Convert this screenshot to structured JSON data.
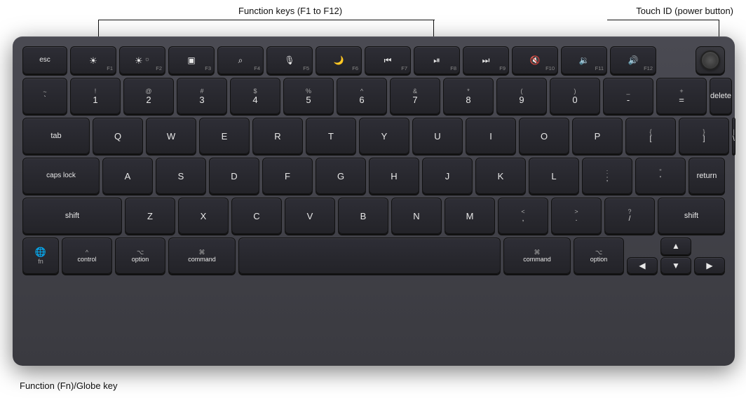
{
  "annotations": {
    "fn_keys_label": "Function keys (F1 to F12)",
    "touchid_label": "Touch ID (power button)",
    "fn_globe_label": "Function (Fn)/Globe key"
  },
  "keyboard": {
    "rows": {
      "fn_row": [
        {
          "id": "esc",
          "primary": "esc",
          "secondary": ""
        },
        {
          "id": "f1",
          "primary": "☀",
          "fn": "F1"
        },
        {
          "id": "f2",
          "primary": "☀",
          "fn": "F2",
          "secondary": "☼"
        },
        {
          "id": "f3",
          "primary": "⊞",
          "fn": "F3"
        },
        {
          "id": "f4",
          "primary": "🔍",
          "fn": "F4"
        },
        {
          "id": "f5",
          "primary": "🎤",
          "fn": "F5"
        },
        {
          "id": "f6",
          "primary": "🌙",
          "fn": "F6"
        },
        {
          "id": "f7",
          "primary": "⏮",
          "fn": "F7"
        },
        {
          "id": "f8",
          "primary": "⏯",
          "fn": "F8"
        },
        {
          "id": "f9",
          "primary": "⏭",
          "fn": "F9"
        },
        {
          "id": "f10",
          "primary": "🔇",
          "fn": "F10"
        },
        {
          "id": "f11",
          "primary": "🔉",
          "fn": "F11"
        },
        {
          "id": "f12",
          "primary": "🔊",
          "fn": "F12"
        }
      ]
    }
  }
}
